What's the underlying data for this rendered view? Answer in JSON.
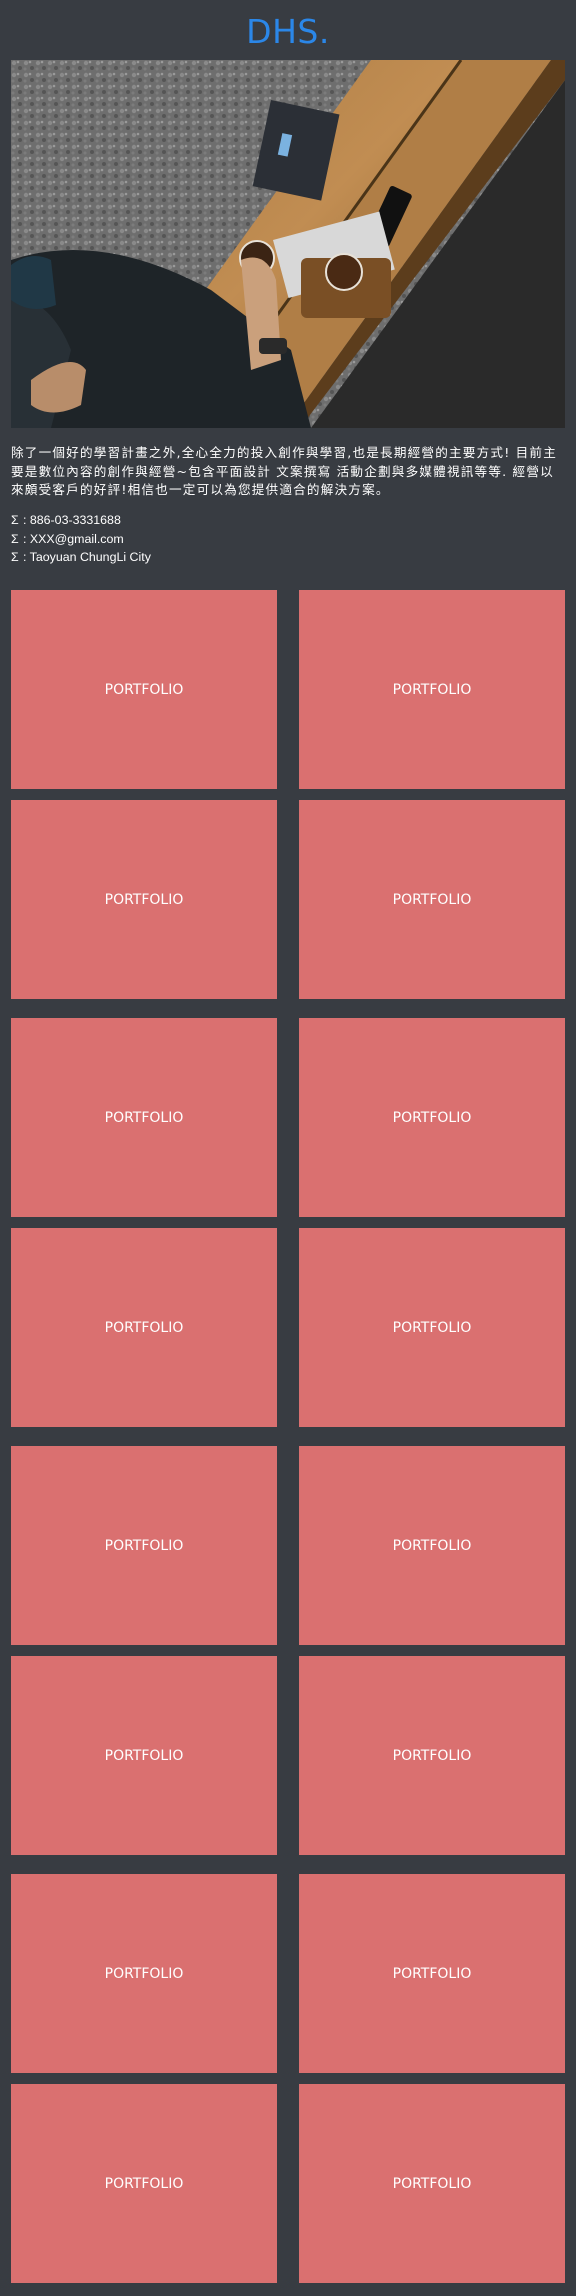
{
  "header": {
    "logo": "DHS."
  },
  "intro": {
    "text": "除了一個好的學習計畫之外,全心全力的投入創作與學習,也是長期經營的主要方式! 目前主要是數位內容的創作與經營~包含平面設計 文案撰寫 活動企劃與多媒體視訊等等. 經營以來頗受客戶的好評!相信也一定可以為您提供適合的解決方案。"
  },
  "contacts": [
    {
      "icon": "phone-icon",
      "glyph": "Σ",
      "text": ": 886-03-3331688"
    },
    {
      "icon": "email-icon",
      "glyph": "Σ",
      "text": ": XXX@gmail.com"
    },
    {
      "icon": "location-icon",
      "glyph": "Σ",
      "text": ": Taoyuan ChungLi City"
    }
  ],
  "portfolio": {
    "cards": [
      {
        "label": "PORTFOLIO"
      },
      {
        "label": "PORTFOLIO"
      },
      {
        "label": "PORTFOLIO"
      },
      {
        "label": "PORTFOLIO"
      },
      {
        "label": "PORTFOLIO"
      },
      {
        "label": "PORTFOLIO"
      },
      {
        "label": "PORTFOLIO"
      },
      {
        "label": "PORTFOLIO"
      },
      {
        "label": "PORTFOLIO"
      },
      {
        "label": "PORTFOLIO"
      },
      {
        "label": "PORTFOLIO"
      },
      {
        "label": "PORTFOLIO"
      },
      {
        "label": "PORTFOLIO"
      },
      {
        "label": "PORTFOLIO"
      },
      {
        "label": "PORTFOLIO"
      },
      {
        "label": "PORTFOLIO"
      }
    ]
  },
  "colors": {
    "background": "#383c42",
    "logo": "#2b87e8",
    "card": "#da7070"
  }
}
